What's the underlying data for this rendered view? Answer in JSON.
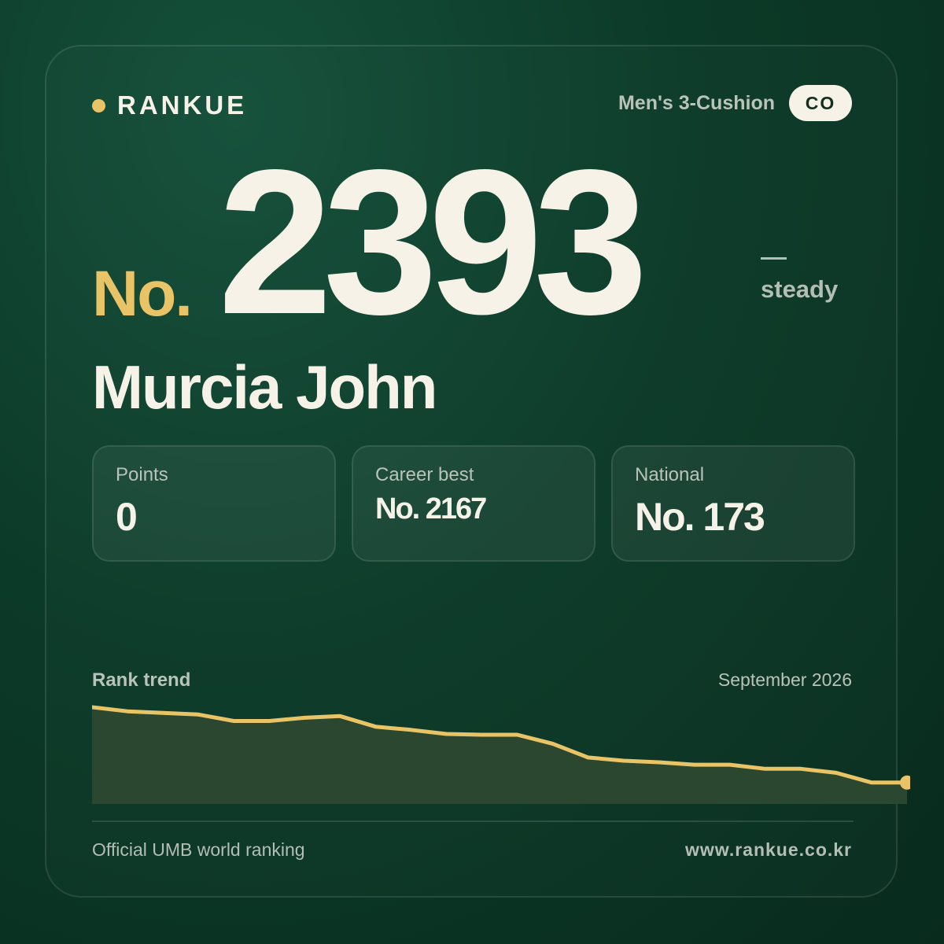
{
  "brand": {
    "name": "RANKUE",
    "dot_color": "#e9c467"
  },
  "category": {
    "label": "Men's 3-Cushion",
    "country_code": "CO"
  },
  "rank": {
    "prefix": "No.",
    "number": "2393",
    "change_symbol": "—",
    "change_label": "steady"
  },
  "player": {
    "name": "Murcia John"
  },
  "stats": [
    {
      "label": "Points",
      "value": "0"
    },
    {
      "label": "Career best",
      "value": "No. 2167"
    },
    {
      "label": "National",
      "value": "No. 173"
    }
  ],
  "trend": {
    "title": "Rank trend",
    "date": "September 2026"
  },
  "chart_data": {
    "type": "area",
    "title": "",
    "xlabel": "",
    "ylabel": "",
    "grid": false,
    "x": [
      1,
      2,
      3,
      4,
      5,
      6,
      7,
      8,
      9,
      10,
      11,
      12,
      13,
      14,
      15,
      16,
      17,
      18,
      19,
      20,
      21,
      22,
      23,
      24
    ],
    "values": [
      0,
      5,
      7,
      9,
      17,
      17,
      13,
      11,
      24,
      28,
      33,
      34,
      34,
      45,
      62,
      66,
      68,
      71,
      71,
      76,
      76,
      81,
      93,
      93
    ],
    "line_color": "#e9c467",
    "fill_color": "#2c4730"
  },
  "footer": {
    "left": "Official UMB world ranking",
    "right": "www.rankue.co.kr"
  },
  "colors": {
    "accent": "#e9c467",
    "background": "#0c3a28",
    "text": "#f6f2e8",
    "muted": "#b9c3b8"
  }
}
